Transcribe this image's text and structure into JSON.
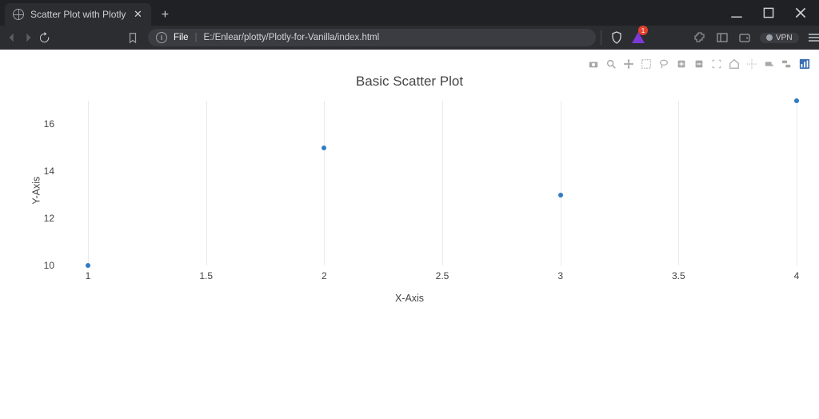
{
  "browser": {
    "tab_title": "Scatter Plot with Plotly",
    "url_scheme": "File",
    "url_path": "E:/Enlear/plotty/Plotly-for-Vanilla/index.html",
    "vpn_label": "VPN",
    "badge_count": "1"
  },
  "chart_data": {
    "type": "scatter",
    "title": "Basic Scatter Plot",
    "xlabel": "X-Axis",
    "ylabel": "Y-Axis",
    "x": [
      1,
      2,
      3,
      4
    ],
    "y": [
      10,
      15,
      13,
      17
    ],
    "xlim": [
      1,
      4
    ],
    "ylim": [
      10,
      17
    ],
    "xticks": [
      1,
      1.5,
      2,
      2.5,
      3,
      3.5,
      4
    ],
    "yticks": [
      10,
      12,
      14,
      16
    ]
  },
  "modebar": {
    "items": [
      "camera",
      "zoom",
      "pan",
      "box-select",
      "lasso",
      "zoom-in",
      "zoom-out",
      "autoscale",
      "reset",
      "spike",
      "show-hover",
      "compare",
      "logo"
    ]
  }
}
